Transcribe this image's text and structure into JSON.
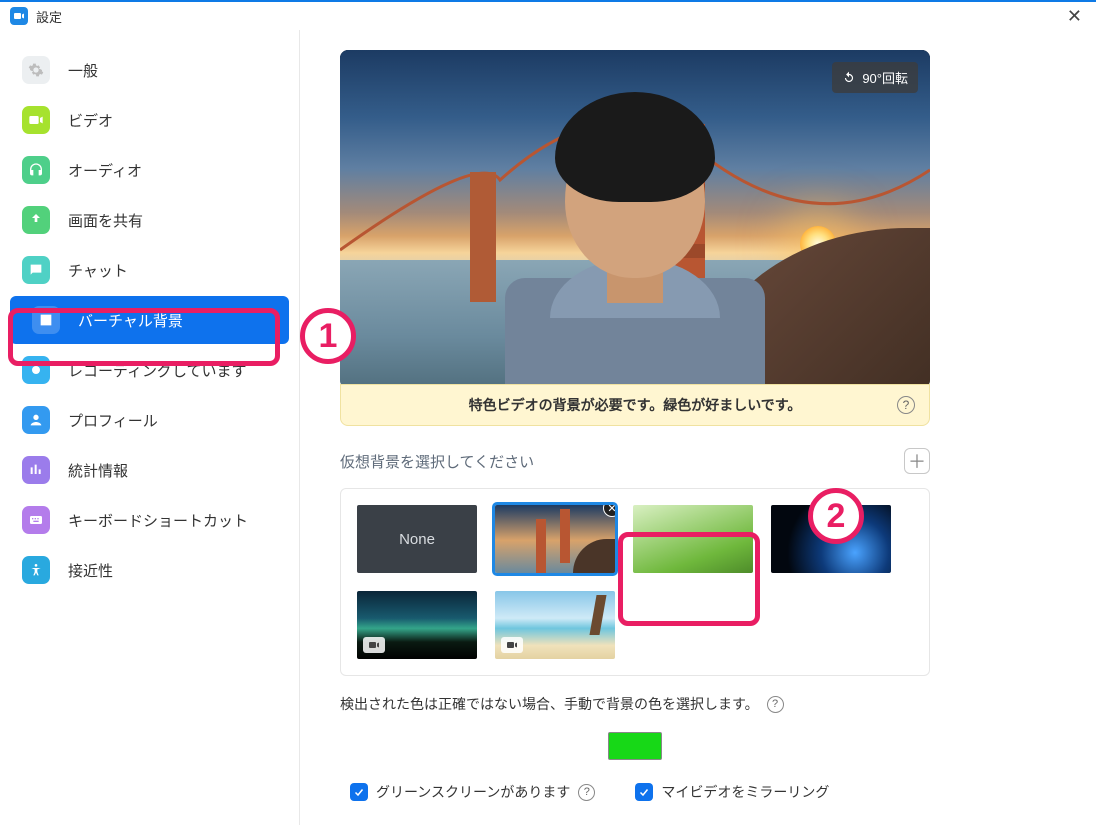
{
  "window": {
    "title": "設定",
    "close": "✕"
  },
  "sidebar": {
    "items": [
      {
        "label": "一般",
        "active": false
      },
      {
        "label": "ビデオ",
        "active": false
      },
      {
        "label": "オーディオ",
        "active": false
      },
      {
        "label": "画面を共有",
        "active": false
      },
      {
        "label": "チャット",
        "active": false
      },
      {
        "label": "バーチャル背景",
        "active": true
      },
      {
        "label": "レコーディングしています",
        "active": false
      },
      {
        "label": "プロフィール",
        "active": false
      },
      {
        "label": "統計情報",
        "active": false
      },
      {
        "label": "キーボードショートカット",
        "active": false
      },
      {
        "label": "接近性",
        "active": false
      }
    ]
  },
  "main": {
    "rotate_label": "90°回転",
    "notice_text": "特色ビデオの背景が必要です。緑色が好ましいです。",
    "select_title": "仮想背景を選択してください",
    "backgrounds": {
      "none_label": "None"
    },
    "color_hint": "検出された色は正確ではない場合、手動で背景の色を選択します。",
    "swatch_color": "#17d817",
    "greenscreen_label": "グリーンスクリーンがあります",
    "mirror_label": "マイビデオをミラーリング",
    "greenscreen_checked": true,
    "mirror_checked": true
  },
  "annotations": {
    "n1": "1",
    "n2": "2"
  }
}
